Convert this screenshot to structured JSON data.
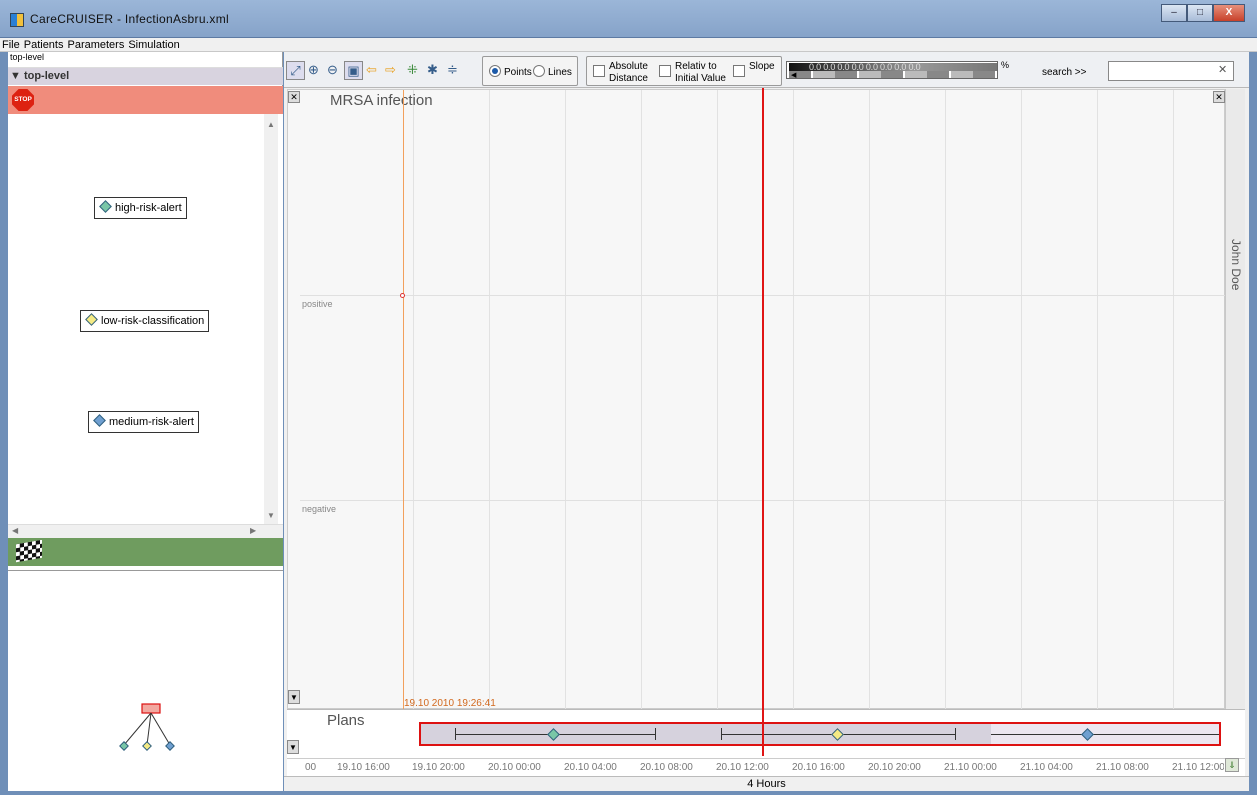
{
  "window": {
    "title": "CareCRUISER - InfectionAsbru.xml",
    "buttons": [
      "–",
      "□",
      "X"
    ]
  },
  "menu": [
    "File",
    "Patients",
    "Parameters",
    "Simulation"
  ],
  "left_panel": {
    "breadcrumb": "top-level",
    "tree_header": "▼ top-level",
    "stop_label": "STOP",
    "plans": [
      {
        "label": "high-risk-alert",
        "color": "#79c7a7"
      },
      {
        "label": "low-risk-classification",
        "color": "#f4ea84"
      },
      {
        "label": "medium-risk-alert",
        "color": "#6f9fd0"
      }
    ],
    "overview_nodes": [
      {
        "color": "#79c7a7"
      },
      {
        "color": "#f4ea84"
      },
      {
        "color": "#6f9fd0"
      }
    ]
  },
  "toolbar": {
    "icons": [
      "pan-icon",
      "zoom-in-icon",
      "zoom-out-icon",
      "fit-icon",
      "back-icon",
      "forward-icon",
      "add-icon",
      "tools-icon",
      "filter-icon"
    ],
    "points_label": "Points",
    "lines_label": "Lines",
    "absolute_label_1": "Absolute",
    "absolute_label_2": "Distance",
    "relative_label_1": "Relativ to",
    "relative_label_2": "Initial Value",
    "slope_label": "Slope",
    "slope_values": "0.0 0.0 0.0 0.0 0.0 0.0 0.0 0.0",
    "slope_unit": "%",
    "search_label": "search >>",
    "search_value": ""
  },
  "chart": {
    "title": "MRSA infection",
    "levels": [
      "positive",
      "negative"
    ],
    "cursor_timestamp": "19.10 2010 19:26:41",
    "patient": "John Doe"
  },
  "plans_row": {
    "label": "Plans"
  },
  "time_axis": {
    "labels": [
      "00",
      "19.10 16:00",
      "19.10 20:00",
      "20.10 00:00",
      "20.10 04:00",
      "20.10 08:00",
      "20.10 12:00",
      "20.10 16:00",
      "20.10 20:00",
      "21.10 00:00",
      "21.10 04:00",
      "21.10 08:00",
      "21.10 12:00"
    ],
    "zoom_label": "4 Hours"
  },
  "colors": {
    "stop_bar": "#f08c7c",
    "finish_bar": "#6f9c5f",
    "current_time": "#e01515",
    "cursor": "#f2a05d"
  }
}
